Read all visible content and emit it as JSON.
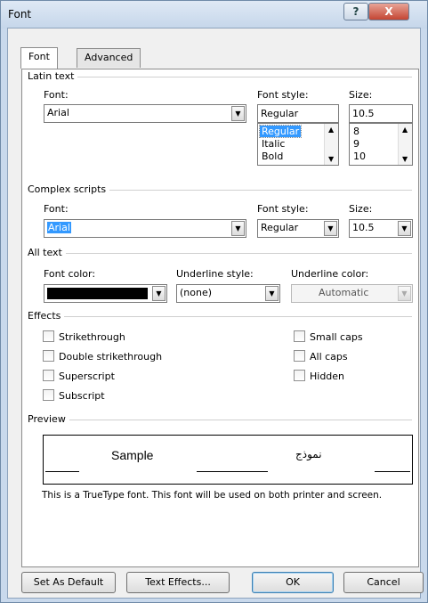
{
  "window": {
    "title": "Font",
    "help_label": "?",
    "close_label": "X"
  },
  "tabs": [
    {
      "label": "Font"
    },
    {
      "label": "Advanced"
    }
  ],
  "latin": {
    "section": "Latin text",
    "font_label": "Font:",
    "font_value": "Arial",
    "style_label": "Font style:",
    "style_value": "Regular",
    "style_options": [
      "Regular",
      "Italic",
      "Bold"
    ],
    "size_label": "Size:",
    "size_value": "10.5",
    "size_options": [
      "8",
      "9",
      "10"
    ]
  },
  "complex": {
    "section": "Complex scripts",
    "font_label": "Font:",
    "font_value": "Arial",
    "style_label": "Font style:",
    "style_value": "Regular",
    "size_label": "Size:",
    "size_value": "10.5"
  },
  "all_text": {
    "section": "All text",
    "color_label": "Font color:",
    "color_value": "#000000",
    "underline_label": "Underline style:",
    "underline_value": "(none)",
    "underline_color_label": "Underline color:",
    "underline_color_value": "Automatic"
  },
  "effects": {
    "section": "Effects",
    "strikethrough": "Strikethrough",
    "double_strikethrough": "Double strikethrough",
    "superscript": "Superscript",
    "subscript": "Subscript",
    "small_caps": "Small caps",
    "all_caps": "All caps",
    "hidden": "Hidden"
  },
  "preview": {
    "section": "Preview",
    "sample": "Sample",
    "sample_rtl": "نموذج",
    "note": "This is a TrueType font. This font will be used on both printer and screen."
  },
  "buttons": {
    "set_default": "Set As Default",
    "text_effects": "Text Effects...",
    "ok": "OK",
    "cancel": "Cancel"
  }
}
